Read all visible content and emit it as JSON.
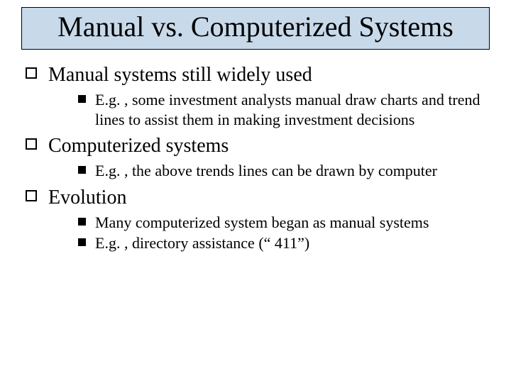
{
  "title": "Manual vs. Computerized Systems",
  "bullets": [
    {
      "text": "Manual systems still widely used",
      "sub": [
        "E.g. , some investment analysts manual draw charts and trend lines to assist them in making investment decisions"
      ]
    },
    {
      "text": "Computerized systems",
      "sub": [
        "E.g. , the above trends lines can be drawn by computer"
      ]
    },
    {
      "text": "Evolution",
      "sub": [
        "Many computerized system began as manual systems",
        "E.g. , directory assistance (“ 411”)"
      ]
    }
  ]
}
